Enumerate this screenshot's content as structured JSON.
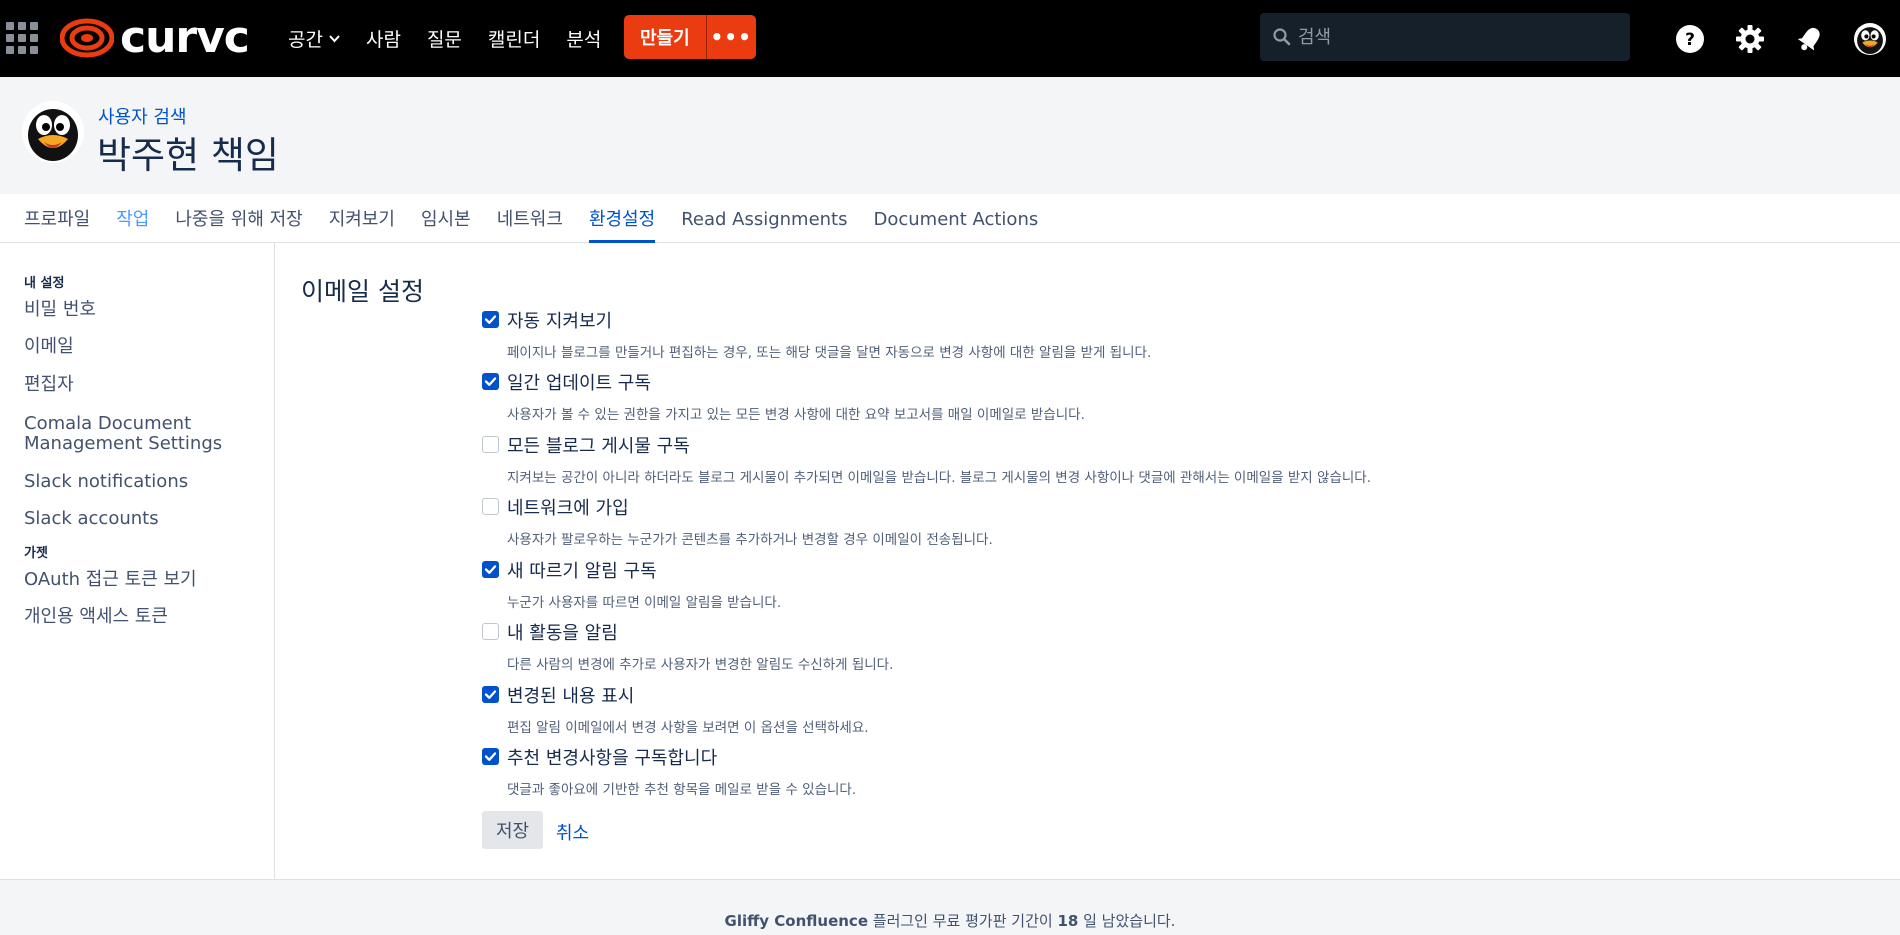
{
  "topnav": {
    "logo_text": "curvc",
    "items": [
      {
        "label": "공간",
        "has_dropdown": true
      },
      {
        "label": "사람"
      },
      {
        "label": "질문"
      },
      {
        "label": "캘린더"
      },
      {
        "label": "분석"
      }
    ],
    "create_label": "만들기",
    "more_label": "•••",
    "search_placeholder": "검색",
    "accent_color": "#ea3c10",
    "icons": [
      "help-icon",
      "gear-icon",
      "notification-icon",
      "user-avatar"
    ]
  },
  "profile": {
    "breadcrumb": "사용자 검색",
    "name": "박주현 책임"
  },
  "tabs": [
    {
      "label": "프로파일"
    },
    {
      "label": "작업"
    },
    {
      "label": "나중을 위해 저장"
    },
    {
      "label": "지켜보기"
    },
    {
      "label": "임시본"
    },
    {
      "label": "네트워크"
    },
    {
      "label": "환경설정",
      "selected": true
    },
    {
      "label": "Read Assignments"
    },
    {
      "label": "Document Actions"
    }
  ],
  "sidebar": {
    "heading_settings": "내 설정",
    "settings_items": [
      {
        "label": "비밀 번호"
      },
      {
        "label": "이메일"
      },
      {
        "label": "편집자"
      },
      {
        "label": "Comala Document Management Settings"
      },
      {
        "label": "Slack notifications"
      },
      {
        "label": "Slack accounts"
      }
    ],
    "heading_gadgets": "가젯",
    "gadget_items": [
      {
        "label": "OAuth 접근 토큰 보기"
      },
      {
        "label": "개인용 액세스 토큰"
      }
    ]
  },
  "email_settings": {
    "title": "이메일 설정",
    "options": [
      {
        "label": "자동 지켜보기",
        "desc": "페이지나 블로그를 만들거나 편집하는 경우, 또는 해당 댓글을 달면 자동으로 변경 사항에 대한 알림을 받게 됩니다.",
        "checked": true
      },
      {
        "label": "일간 업데이트 구독",
        "desc": "사용자가 볼 수 있는 권한을 가지고 있는 모든 변경 사항에 대한 요약 보고서를 매일 이메일로 받습니다.",
        "checked": true
      },
      {
        "label": "모든 블로그 게시물 구독",
        "desc": "지켜보는 공간이 아니라 하더라도 블로그 게시물이 추가되면 이메일을 받습니다. 블로그 게시물의 변경 사항이나 댓글에 관해서는 이메일을 받지 않습니다.",
        "checked": false
      },
      {
        "label": "네트워크에 가입",
        "desc": "사용자가 팔로우하는 누군가가 콘텐츠를 추가하거나 변경할 경우 이메일이 전송됩니다.",
        "checked": false
      },
      {
        "label": "새 따르기 알림 구독",
        "desc": "누군가 사용자를 따르면 이메일 알림을 받습니다.",
        "checked": true
      },
      {
        "label": "내 활동을 알림",
        "desc": "다른 사람의 변경에 추가로 사용자가 변경한 알림도 수신하게 됩니다.",
        "checked": false
      },
      {
        "label": "변경된 내용 표시",
        "desc": "편집 알림 이메일에서 변경 사항을 보려면 이 옵션을 선택하세요.",
        "checked": true
      },
      {
        "label": "추천 변경사항을 구독합니다",
        "desc": "댓글과 좋아요에 기반한 추천 항목을 메일로 받을 수 있습니다.",
        "checked": true
      }
    ],
    "save_label": "저장",
    "cancel_label": "취소"
  },
  "footer": {
    "product": "Gliffy Confluence",
    "text_1": " 플러그인 무료 평가판 기간이 ",
    "days": "18",
    "text_2": " 일 남았습니다."
  }
}
